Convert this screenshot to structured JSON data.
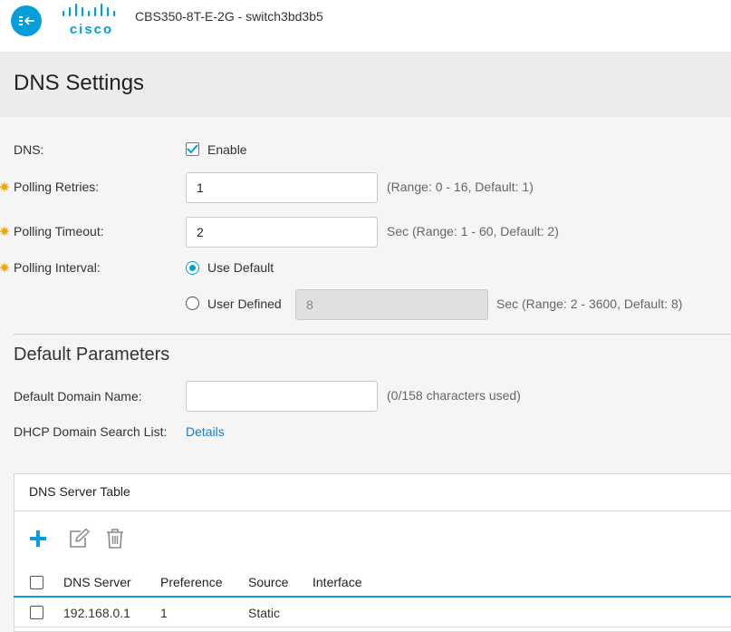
{
  "header": {
    "brand": "cisco",
    "device_name": "CBS350-8T-E-2G - switch3bd3b5",
    "nav_icon": "collapse-nav-icon"
  },
  "page": {
    "title": "DNS Settings"
  },
  "dns": {
    "label": "DNS:",
    "enable_label": "Enable",
    "enabled": true
  },
  "polling_retries": {
    "label": "Polling Retries:",
    "value": "1",
    "hint": "(Range: 0 - 16, Default: 1)"
  },
  "polling_timeout": {
    "label": "Polling Timeout:",
    "value": "2",
    "hint": "Sec (Range: 1 - 60, Default: 2)"
  },
  "polling_interval": {
    "label": "Polling Interval:",
    "use_default_label": "Use Default",
    "user_defined_label": "User Defined",
    "user_defined_value": "8",
    "hint": "Sec (Range: 2 - 3600, Default: 8)",
    "selected": "use_default"
  },
  "default_params": {
    "title": "Default Parameters",
    "domain_name_label": "Default Domain Name:",
    "domain_name_value": "",
    "domain_name_hint": "(0/158 characters used)",
    "dhcp_search_label": "DHCP Domain Search List:",
    "dhcp_search_link": "Details"
  },
  "dns_table": {
    "title": "DNS Server Table",
    "columns": [
      "DNS Server",
      "Preference",
      "Source",
      "Interface"
    ],
    "rows": [
      {
        "server": "192.168.0.1",
        "preference": "1",
        "source": "Static",
        "interface": ""
      }
    ]
  },
  "colors": {
    "accent": "#049fd9",
    "required": "#f0a500",
    "link": "#1e7bc4"
  }
}
